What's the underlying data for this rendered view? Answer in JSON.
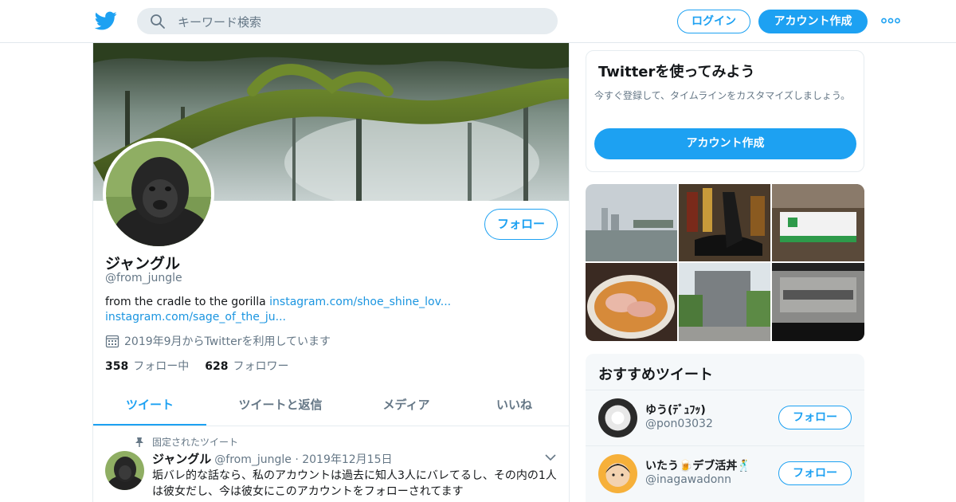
{
  "header": {
    "search_placeholder": "キーワード検索",
    "login_label": "ログイン",
    "signup_label": "アカウント作成"
  },
  "profile": {
    "name": "ジャングル",
    "handle": "@from_jungle",
    "follow_label": "フォロー",
    "bio_text": "from the cradle to the gorilla",
    "bio_link1": "instagram.com/shoe_shine_lov...",
    "bio_link2": "instagram.com/sage_of_the_ju...",
    "joined": "2019年9月からTwitterを利用しています",
    "following_count": "358",
    "following_label": "フォロー中",
    "followers_count": "628",
    "followers_label": "フォロワー"
  },
  "tabs": [
    {
      "label": "ツイート",
      "active": true
    },
    {
      "label": "ツイートと返信",
      "active": false
    },
    {
      "label": "メディア",
      "active": false
    },
    {
      "label": "いいね",
      "active": false
    }
  ],
  "pinned_tweet": {
    "pinned_label": "固定されたツイート",
    "name": "ジャングル",
    "handle": "@from_jungle",
    "date": "2019年12月15日",
    "text": "垢バレ的な話なら、私のアカウントは過去に知人3人にバレてるし、その内の1人は彼女だし、今は彼女にこのアカウントをフォローされてます"
  },
  "signup_card": {
    "title": "Twitterを使ってみよう",
    "description": "今すぐ登録して、タイムラインをカスタマイズしましょう。",
    "button_label": "アカウント作成"
  },
  "recommendations": {
    "title": "おすすめツイート",
    "items": [
      {
        "name": "ゆう(ﾃﾞｭﾌｯ)",
        "handle": "@pon03032",
        "follow_label": "フォロー"
      },
      {
        "name": "いたう🍺デブ活丼🕺",
        "handle": "@inagawadonn",
        "follow_label": "フォロー"
      }
    ]
  },
  "colors": {
    "accent": "#1da1f2",
    "link": "#1b95e0",
    "secondary_text": "#657786",
    "border": "#e6ecf0"
  }
}
